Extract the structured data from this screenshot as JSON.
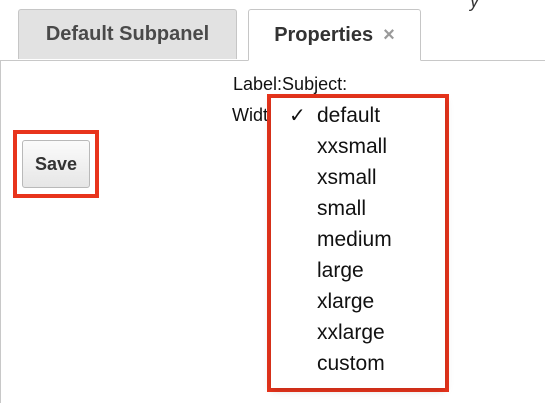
{
  "header_fragment": "y",
  "tabs": {
    "default_subpanel": "Default Subpanel",
    "properties": "Properties",
    "close_symbol": "×"
  },
  "form": {
    "label_text": "Label:",
    "label_value": "Subject:",
    "width_label_partial": "Widt",
    "save_button": "Save"
  },
  "dropdown": {
    "selected": "default",
    "check_mark": "✓",
    "options": [
      "default",
      "xxsmall",
      "xsmall",
      "small",
      "medium",
      "large",
      "xlarge",
      "xxlarge",
      "custom"
    ]
  },
  "colors": {
    "highlight": "#e8341c",
    "tab_inactive_bg": "#e2e2e2",
    "border": "#c8c8c8"
  }
}
